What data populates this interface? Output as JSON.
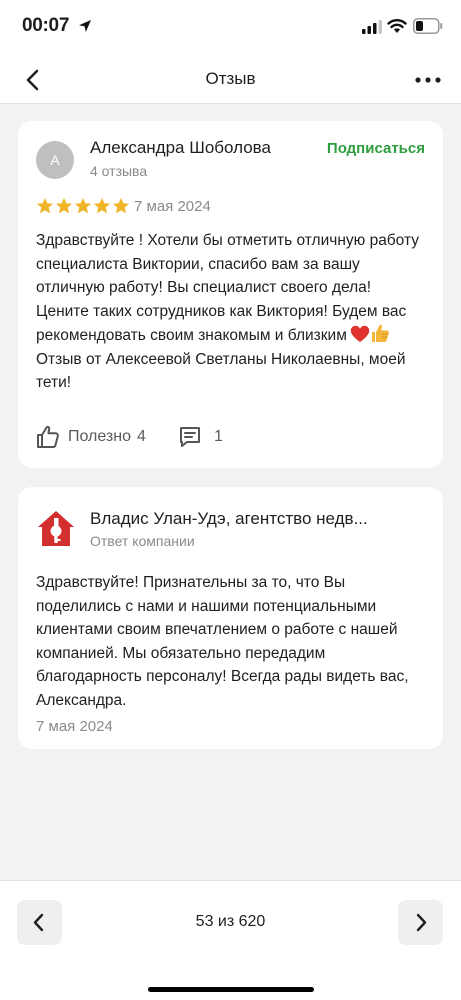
{
  "status_bar": {
    "time": "00:07",
    "icons": [
      "location-arrow-icon",
      "cellular-signal-icon",
      "wifi-icon",
      "battery-icon"
    ]
  },
  "header": {
    "title": "Отзыв",
    "back_icon": "chevron-left-icon",
    "more_icon": "more-horizontal-icon"
  },
  "review": {
    "avatar_letter": "А",
    "author": "Александра Шоболова",
    "reviews_count": "4 отзыва",
    "subscribe_label": "Подписаться",
    "rating": 5,
    "rating_max": 5,
    "date": "7 мая 2024",
    "text_main": "Здравствуйте ! Хотели бы отметить отличную работу специалиста Виктории, спасибо вам за вашу отличную работу! Вы специалист своего дела! Цените таких сотрудников как Виктория! Будем вас рекомендовать своим знакомым и близким",
    "text_emoji": [
      "red-heart-emoji",
      "thumbs-up-emoji"
    ],
    "text_tail": "Отзыв от Алексеевой Светланы Николаевны, моей тети!",
    "helpful_label": "Полезно",
    "helpful_count": "4",
    "comments_count": "1",
    "colors": {
      "star": "#f0b429",
      "subscribe": "#2e9e3e"
    }
  },
  "reply": {
    "company_name": "Владис Улан-Удэ, агентство недв...",
    "label": "Ответ компании",
    "text": "Здравствуйте! Признательны за то, что Вы поделились с нами и нашими потенциальными клиентами своим впечатлением о работе с нашей компанией. Мы обязательно передадим благодарность персоналу! Всегда рады видеть вас, Александра.",
    "date": "7 мая 2024",
    "logo_icon": "house-key-logo-icon",
    "colors": {
      "logo": "#d32f2f"
    }
  },
  "pager": {
    "text": "53 из 620",
    "prev_icon": "chevron-left-icon",
    "next_icon": "chevron-right-icon"
  }
}
